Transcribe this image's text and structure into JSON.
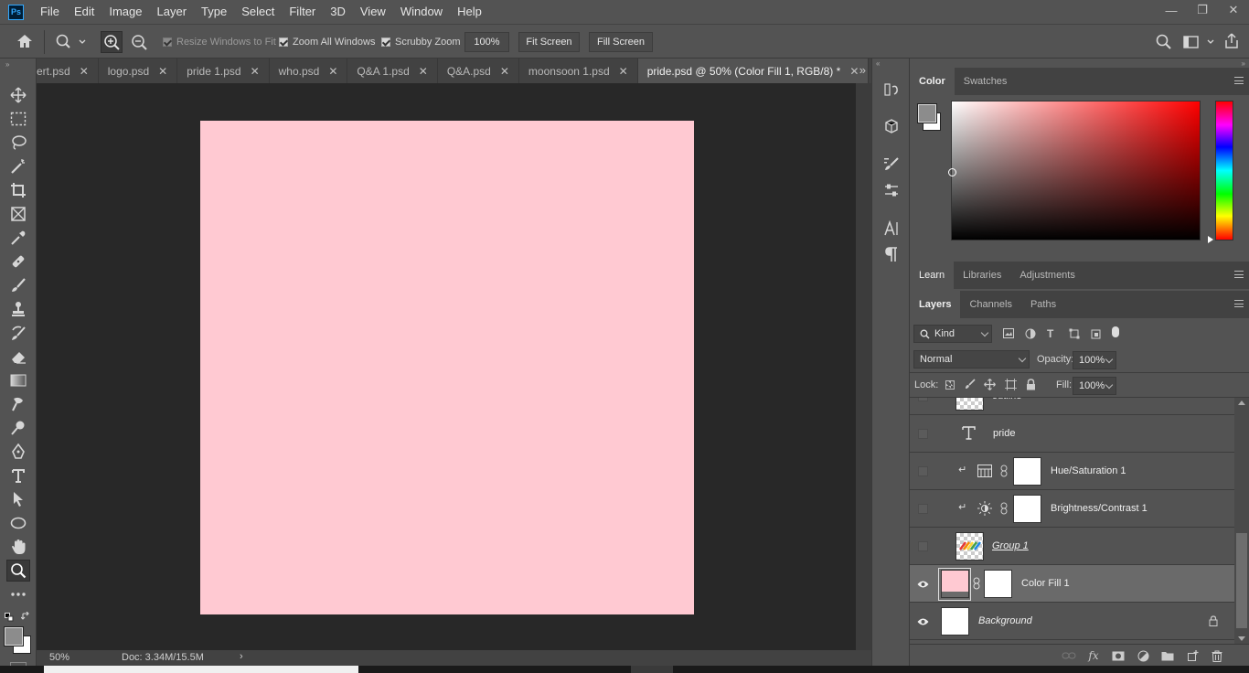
{
  "app": {
    "logo": "Ps"
  },
  "menu": [
    "File",
    "Edit",
    "Image",
    "Layer",
    "Type",
    "Select",
    "Filter",
    "3D",
    "View",
    "Window",
    "Help"
  ],
  "options": {
    "resize_windows": "Resize Windows to Fit",
    "zoom_all": "Zoom All Windows",
    "scrubby": "Scrubby Zoom",
    "zoom_value": "100%",
    "fit_screen": "Fit Screen",
    "fill_screen": "Fill Screen"
  },
  "tabs": [
    {
      "label": "ert.psd",
      "active": false
    },
    {
      "label": "logo.psd",
      "active": false
    },
    {
      "label": "pride 1.psd",
      "active": false
    },
    {
      "label": "who.psd",
      "active": false
    },
    {
      "label": "Q&A 1.psd",
      "active": false
    },
    {
      "label": "Q&A.psd",
      "active": false
    },
    {
      "label": "moonsoon 1.psd",
      "active": false
    },
    {
      "label": "pride.psd @ 50% (Color Fill 1, RGB/8) *",
      "active": true
    }
  ],
  "canvas": {
    "fill_color": "#ffc9d2"
  },
  "status": {
    "zoom": "50%",
    "doc": "Doc: 3.34M/15.5M"
  },
  "color_panel": {
    "tabs": [
      "Color",
      "Swatches"
    ],
    "hue_color": "#ff0000"
  },
  "mid_panel": {
    "tabs": [
      "Learn",
      "Libraries",
      "Adjustments"
    ]
  },
  "layers_panel": {
    "tabs": [
      "Layers",
      "Channels",
      "Paths"
    ],
    "kind": "Kind",
    "blend_mode": "Normal",
    "opacity_label": "Opacity:",
    "opacity": "100%",
    "lock_label": "Lock:",
    "fill_label": "Fill:",
    "fill": "100%",
    "layers": [
      {
        "name": "outline",
        "visible": false
      },
      {
        "name": "pride",
        "visible": false
      },
      {
        "name": "Hue/Saturation 1",
        "visible": false
      },
      {
        "name": "Brightness/Contrast 1",
        "visible": false
      },
      {
        "name": "Group 1",
        "visible": false
      },
      {
        "name": "Color Fill 1",
        "visible": true,
        "selected": true
      },
      {
        "name": "Background",
        "visible": true
      }
    ]
  }
}
